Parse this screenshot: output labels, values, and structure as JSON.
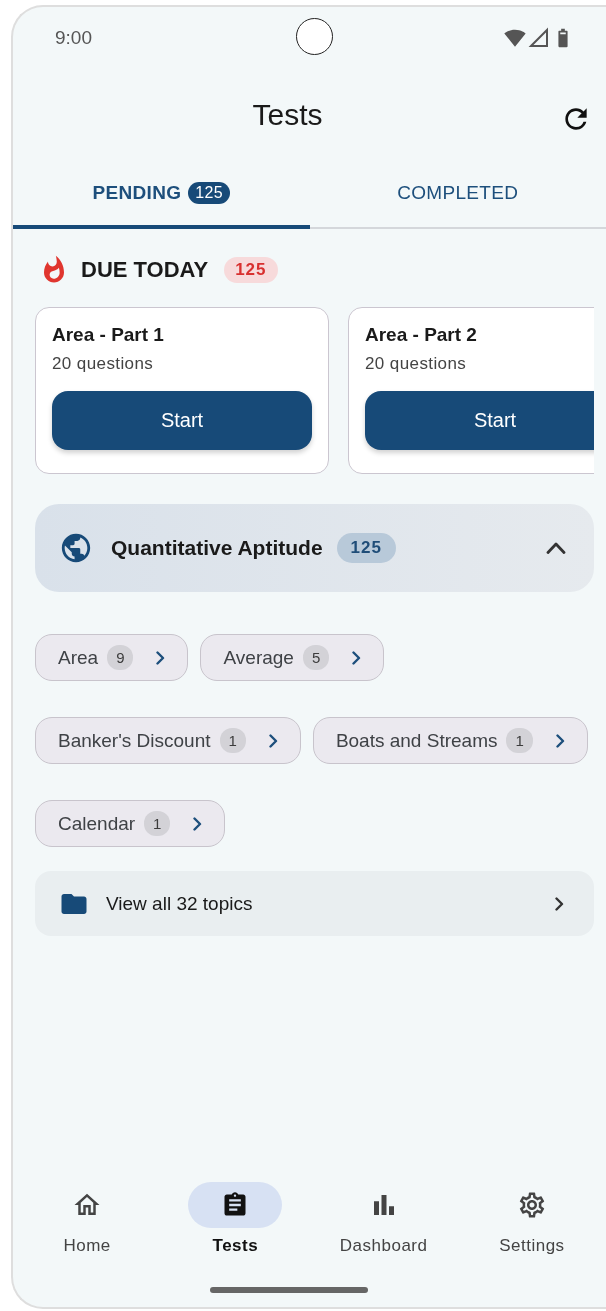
{
  "status_bar": {
    "time": "9:00"
  },
  "header": {
    "title": "Tests"
  },
  "tabs": [
    {
      "label": "PENDING",
      "badge": "125",
      "selected": true
    },
    {
      "label": "COMPLETED",
      "selected": false
    }
  ],
  "due_today": {
    "title": "DUE TODAY",
    "count": "125",
    "cards": [
      {
        "title": "Area - Part 1",
        "subtitle": "20 questions",
        "button": "Start"
      },
      {
        "title": "Area - Part 2",
        "subtitle": "20 questions",
        "button": "Start"
      }
    ]
  },
  "section": {
    "title": "Quantitative Aptitude",
    "count": "125",
    "expanded": true,
    "topics": [
      {
        "name": "Area",
        "count": "9"
      },
      {
        "name": "Average",
        "count": "5"
      },
      {
        "name": "Banker's Discount",
        "count": "1"
      },
      {
        "name": "Boats and Streams",
        "count": "1"
      },
      {
        "name": "Calendar",
        "count": "1"
      }
    ],
    "view_all": "View all 32 topics"
  },
  "bottom_nav": [
    {
      "label": "Home",
      "kind": "home",
      "selected": false
    },
    {
      "label": "Tests",
      "kind": "tests",
      "selected": true
    },
    {
      "label": "Dashboard",
      "kind": "dashboard",
      "selected": false
    },
    {
      "label": "Settings",
      "kind": "settings",
      "selected": false
    }
  ]
}
